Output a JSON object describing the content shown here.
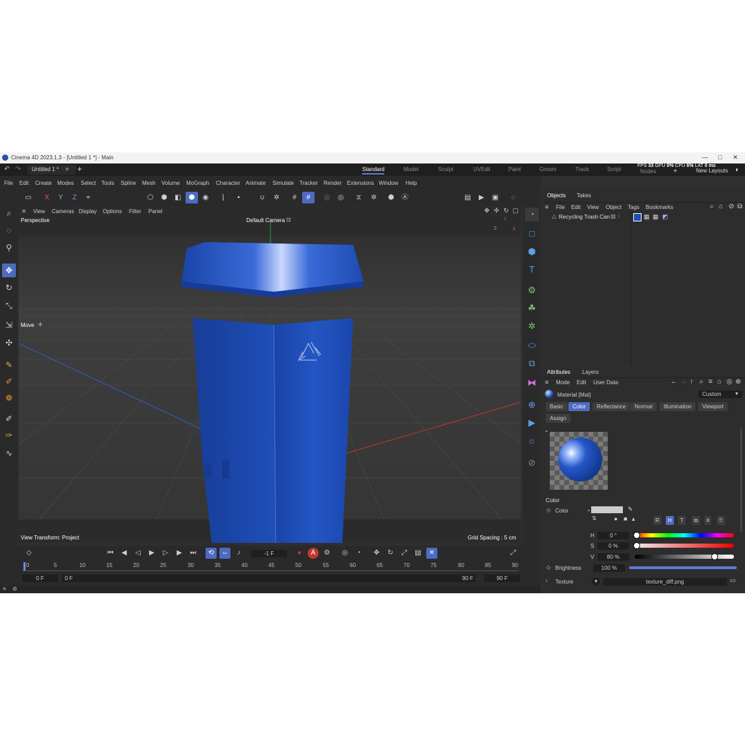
{
  "window": {
    "title": "Cinema 4D 2023.1.3 - [Untitled 1 *] - Main",
    "minimize": "—",
    "maximize": "□",
    "close": "✕"
  },
  "tabs": {
    "document": "Untitled 1 *",
    "add": "+",
    "layouts": [
      "Standard",
      "Model",
      "Sculpt",
      "UVEdit",
      "Paint",
      "Groom",
      "Track",
      "Script",
      "Nodes"
    ],
    "new_layouts": "New Layouts",
    "stats": {
      "fps_label": "FPS",
      "fps_value": "33",
      "gpu_label": "GPU",
      "gpu_value": "0%",
      "cpu_label": "CPU",
      "cpu_value": "6%",
      "lat_label": "LAT",
      "lat_value": "0 ms"
    }
  },
  "menubar": [
    "File",
    "Edit",
    "Create",
    "Modes",
    "Select",
    "Tools",
    "Spline",
    "Mesh",
    "Volume",
    "MoGraph",
    "Character",
    "Animate",
    "Simulate",
    "Tracker",
    "Render",
    "Extensions",
    "Window",
    "Help"
  ],
  "toolbar": {
    "axis_x": "X",
    "axis_y": "Y",
    "axis_z": "Z"
  },
  "viewport": {
    "menu": [
      "View",
      "Cameras",
      "Display",
      "Options",
      "Filter",
      "Panel"
    ],
    "projection": "Perspective",
    "camera": "Default Camera",
    "tool": "Move",
    "view_transform": "View Transform: Project",
    "grid_spacing": "Grid Spacing : 5 cm",
    "axis_y": "Y",
    "axis_z": "Z",
    "axis_x": "X"
  },
  "timeline": {
    "current_frame": "-1 F",
    "ruler": [
      "0",
      "5",
      "10",
      "15",
      "20",
      "25",
      "30",
      "35",
      "40",
      "45",
      "50",
      "55",
      "60",
      "65",
      "70",
      "75",
      "80",
      "85",
      "90"
    ],
    "start": "0 F",
    "range_start": "0 F",
    "range_end": "90 F",
    "end": "90 F",
    "record_label": "A"
  },
  "objects_panel": {
    "tabs": [
      "Objects",
      "Takes"
    ],
    "menu": [
      "File",
      "Edit",
      "View",
      "Object",
      "Tags",
      "Bookmarks"
    ],
    "object_name": "Recycling Trash Can"
  },
  "attributes_panel": {
    "tabs": [
      "Attributes",
      "Layers"
    ],
    "menu": [
      "Mode",
      "Edit",
      "User Data"
    ],
    "material_label": "Material [Mat]",
    "preset": "Custom",
    "modes": [
      "Basic",
      "Color",
      "Reflectance",
      "Normal",
      "Illumination",
      "Viewport"
    ],
    "assign": "Assign",
    "section": "Color",
    "color_label": "Color",
    "color_models": [
      "R",
      "H",
      "T"
    ],
    "h_label": "H",
    "h_value": "0 °",
    "s_label": "S",
    "s_value": "0 %",
    "v_label": "V",
    "v_value": "80 %",
    "brightness_label": "Brightness",
    "brightness_value": "100 %",
    "texture_label": "Texture",
    "texture_value": "texture_diff.png"
  },
  "colors": {
    "accent": "#4d6bc2",
    "can_blue": "#1f4fb0",
    "axis_red": "#c0392b",
    "axis_blue": "#2f5fc8",
    "axis_green": "#2ea043"
  }
}
